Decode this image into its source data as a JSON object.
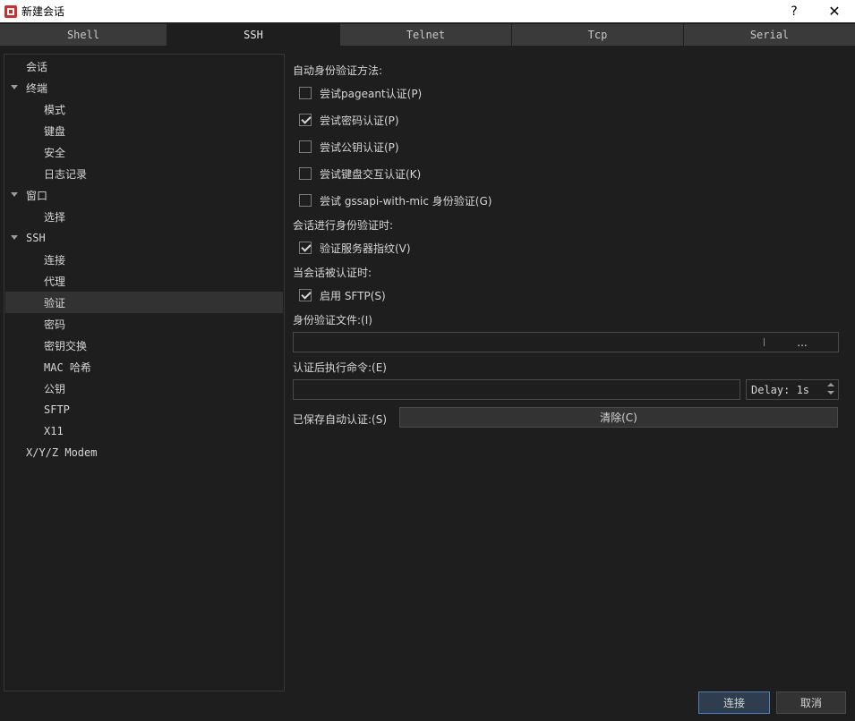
{
  "window": {
    "title": "新建会话",
    "help_label": "?",
    "close_label": "✕"
  },
  "tabs": [
    {
      "label": "Shell",
      "active": false
    },
    {
      "label": "SSH",
      "active": true
    },
    {
      "label": "Telnet",
      "active": false
    },
    {
      "label": "Tcp",
      "active": false
    },
    {
      "label": "Serial",
      "active": false
    }
  ],
  "tree": {
    "session": "会话",
    "terminal": "终端",
    "mode": "模式",
    "keyboard": "键盘",
    "security": "安全",
    "logging": "日志记录",
    "window": "窗口",
    "selection": "选择",
    "ssh": "SSH",
    "connection": "连接",
    "proxy": "代理",
    "auth": "验证",
    "cipher": "密码",
    "kex": "密钥交换",
    "mac": "MAC 哈希",
    "pubkey": "公钥",
    "sftp": "SFTP",
    "x11": "X11",
    "xyz_modem": "X/Y/Z Modem"
  },
  "auth": {
    "methods_heading": "自动身份验证方法:",
    "methods": [
      {
        "label": "尝试pageant认证(P)",
        "checked": false
      },
      {
        "label": "尝试密码认证(P)",
        "checked": true
      },
      {
        "label": "尝试公钥认证(P)",
        "checked": false
      },
      {
        "label": "尝试键盘交互认证(K)",
        "checked": false
      },
      {
        "label": "尝试 gssapi-with-mic 身份验证(G)",
        "checked": false
      }
    ],
    "during_auth_heading": "会话进行身份验证时:",
    "verify_host_label": "验证服务器指纹(V)",
    "verify_host_checked": true,
    "after_auth_heading": "当会话被认证时:",
    "enable_sftp_label": "启用 SFTP(S)",
    "enable_sftp_checked": true,
    "identity_file_label": "身份验证文件:(I)",
    "identity_file_value": "",
    "browse_label": "...",
    "post_cmd_label": "认证后执行命令:(E)",
    "post_cmd_value": "",
    "delay_value": "Delay: 1s",
    "saved_auth_label": "已保存自动认证:(S)",
    "clear_label": "清除(C)"
  },
  "footer": {
    "connect_label": "连接",
    "cancel_label": "取消"
  },
  "colors": {
    "background": "#1e1e1e",
    "tab_inactive": "#3a3a3a",
    "selection": "#323232",
    "primary_border": "#4f7fb8"
  }
}
